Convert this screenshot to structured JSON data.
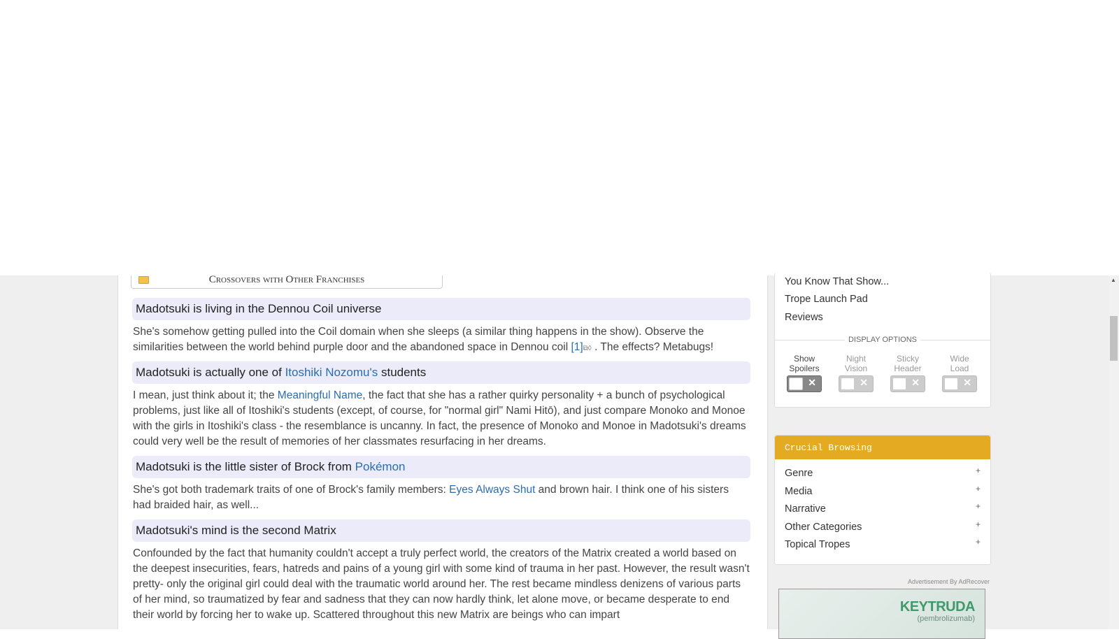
{
  "crossovers_folder": {
    "title": "Crossovers with Other Franchises",
    "icon": "folder-icon"
  },
  "wmgs": [
    {
      "head_text": "Madotsuki is living in the Dennou Coil universe",
      "head_parts": [],
      "body_parts": [
        {
          "t": "She's somehow getting pulled into the Coil domain when she sleeps (a similar thing happens in the show). Observe the similarities between the world behind purple door and the abandoned space in Dennou coil "
        },
        {
          "t": "[1]",
          "link": true
        },
        {
          "t": "⧉◊",
          "icon": true
        },
        {
          "t": " . The effects? Metabugs!"
        }
      ]
    },
    {
      "head_parts": [
        {
          "t": "Madotsuki is actually one of "
        },
        {
          "t": "Itoshiki Nozomu's",
          "link": true
        },
        {
          "t": " students"
        }
      ],
      "body_parts": [
        {
          "t": "I mean, just think about it; the "
        },
        {
          "t": "Meaningful Name",
          "link": true
        },
        {
          "t": ", the fact that she has a rather quirky personality + a bunch of psychological problems, just like all of Itoshiki's students (except, of course, for \"normal girl\" Nami Hitō), and just compare Monoko and Monoe with the girls in Itoshiki's class - the resemblance is uncanny. In fact, the presence of Monoko and Monoe in Madotsuki's dreams could very well be the result of memories of her classmates resurfacing in her dreams."
        }
      ]
    },
    {
      "head_parts": [
        {
          "t": "Madotsuki is the little sister of Brock from "
        },
        {
          "t": "Pokémon",
          "link": true
        }
      ],
      "body_parts": [
        {
          "t": "She's got both trademark traits of one of Brock's family members: "
        },
        {
          "t": "Eyes Always Shut",
          "link": true
        },
        {
          "t": " and brown hair. I think one of his sisters had braided hair, as well..."
        }
      ]
    },
    {
      "head_parts": [
        {
          "t": "Madotsuki's mind is the second Matrix"
        }
      ],
      "body_parts": [
        {
          "t": "Confounded by the fact that humanity couldn't accept a truly perfect world, the creators of the Matrix created a world based on the deepest insecurities, fears, hatreds and pains of a young girl with some kind of trauma in her past. However, the result wasn't pretty- only the original girl could deal with the traumatic world around her. The rest became mindless denizens of various parts of her mind, so traumatized by fear and sadness that they can now hardly think, let alone move, or became desperate to end their world by forcing her to wake up. Scattered throughout this new Matrix are beings who can impart"
        }
      ]
    }
  ],
  "sidebar": {
    "links": [
      "You Know That Show...",
      "Trope Launch Pad",
      "Reviews"
    ],
    "display_options_label": "DISPLAY OPTIONS",
    "toggles": [
      {
        "label1": "Show",
        "label2": "Spoilers",
        "active": true
      },
      {
        "label1": "Night",
        "label2": "Vision",
        "active": false
      },
      {
        "label1": "Sticky",
        "label2": "Header",
        "active": false
      },
      {
        "label1": "Wide",
        "label2": "Load",
        "active": false
      }
    ],
    "crucial_title": "Crucial Browsing",
    "crucial_items": [
      "Genre",
      "Media",
      "Narrative",
      "Other Categories",
      "Topical Tropes"
    ],
    "ad_label": "Advertisement By AdRecover",
    "ad_brand": "KEYTRUDA",
    "ad_sub": "(pembrolizumab)"
  },
  "colors": {
    "link": "#2a6db0",
    "accent": "#e4aa22",
    "wmg_head_bg": "#ebebf9"
  }
}
